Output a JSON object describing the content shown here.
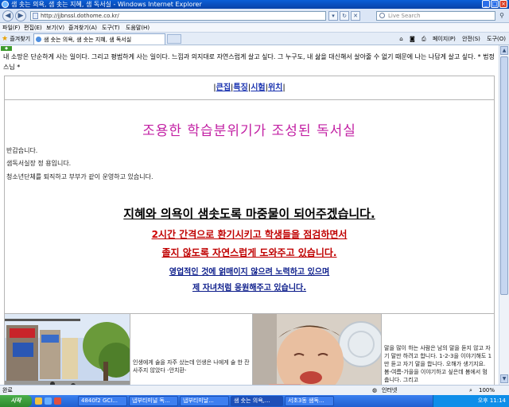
{
  "window": {
    "title": "샘 솟는 의욕, 샘 솟는 지혜, 샘 독서실 - Windows Internet Explorer",
    "address": "http://jjbnssl.dothome.co.kr/",
    "search_placeholder": "Live Search"
  },
  "menu": [
    "파일(F)",
    "편집(E)",
    "보기(V)",
    "즐겨찾기(A)",
    "도구(T)",
    "도움말(H)"
  ],
  "tabs": {
    "favorites_label": "즐겨찾기",
    "active_tab": "샘 솟는 의욕, 샘 솟는 지혜, 샘 독서실"
  },
  "toolbar_right": {
    "page_label": "페이지(P)",
    "safety_label": "안전(S)",
    "tools_label": "도구(O)"
  },
  "page": {
    "quote": "내 소망은 단순하게 사는 일이다. 그리고 평범하게 사는 일이다. 느낌과 의지대로 자연스럽게 살고 싶다. 그 누구도, 내 삶을 대신해서 살아줄 수 없기 때문에 나는 나답게 살고 싶다. * 법정 스님 *",
    "nav": [
      "큰집",
      "특징",
      "시험",
      "위치"
    ],
    "headline": "조용한 학습분위기가 조성된 독서실",
    "intro": [
      "반갑습니다.",
      "샘독서실장 정 용입니다.",
      "청소년단체를 퇴직하고 부부가 같이 운영하고 있습니다."
    ],
    "line1": "지혜와 의욕이 샘솟도록 마중물이 되어주겠습니다.",
    "line2_prefix": "2",
    "line2_rest": "시간 간격으로 환기시키고 학생들을 점검하면서",
    "line3": "졸지 않도록 자연스럽게 도와주고 있습니다.",
    "line4": "영업적인 것에 얽매이지 않으려 노력하고 있으며",
    "line5": "제 자녀처럼 응원해주고 있습니다.",
    "gallery": {
      "caption2": "인생에게 술을 자주 샀는데 인생은 나에게 술 한 잔 사주지 않았다 -안치환-",
      "caption4": "말을 많이 하는 사람은 남의 말을 듣지 않고 자기 말만 하려고 합니다. 1-2-3을 이야기해도 1만 듣고 자기 말을 합니다. 오해가 생기지요. 봄-여름-가을을 이야기하고 싶은데 봄에서 멈춥니다. 그리고"
    }
  },
  "status": {
    "left": "완료",
    "zone": "인터넷",
    "zoom": "100%"
  },
  "taskbar": {
    "start": "시작",
    "buttons": [
      "4840f2 GCI...",
      "냅부티미널 독...",
      "냅부티미날...",
      "샘 솟는 의욕,...",
      "서초3동 샘독..."
    ],
    "clock": "오후 11:14"
  },
  "colors": {
    "headline": "#c21fa3",
    "line1": "#000000",
    "line2": "#c00000",
    "line4": "#0a1b8a",
    "nav_link": "#1a33b0"
  },
  "icons": [
    "back-icon",
    "forward-icon",
    "refresh-icon",
    "stop-icon",
    "search-icon",
    "favorites-star-icon",
    "home-icon",
    "rss-icon",
    "print-icon"
  ]
}
